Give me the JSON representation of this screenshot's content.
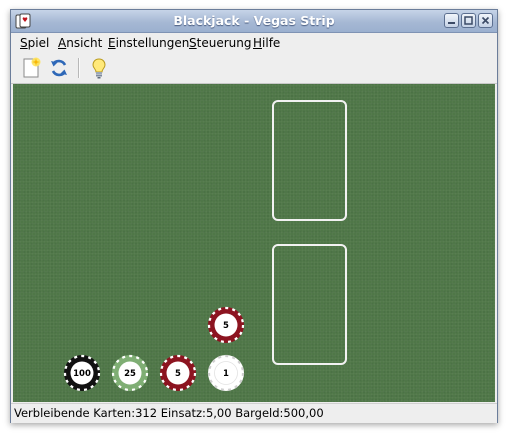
{
  "window": {
    "title": "Blackjack - Vegas Strip",
    "buttons": [
      "minimize-icon",
      "maximize-icon",
      "close-icon"
    ]
  },
  "menu": [
    {
      "mnemonic": "S",
      "rest": "piel"
    },
    {
      "mnemonic": "A",
      "rest": "nsicht"
    },
    {
      "mnemonic": "E",
      "rest": "instellungen"
    },
    {
      "mnemonic": "S",
      "rest": "teuerung"
    },
    {
      "mnemonic": "H",
      "rest": "ilfe"
    }
  ],
  "toolbar": {
    "icons": [
      "new-game-icon",
      "restart-icon",
      "hint-lightbulb-icon"
    ]
  },
  "chips": [
    {
      "value": "100",
      "color": "#111111",
      "accent": "#ffffff"
    },
    {
      "value": "25",
      "color": "#7fae74",
      "accent": "#ffffff"
    },
    {
      "value": "5",
      "color": "#8c1420",
      "accent": "#ffffff"
    },
    {
      "value": "1",
      "color": "#ffffff",
      "accent": "#cfcfcf"
    },
    {
      "value": "5",
      "color": "#8c1420",
      "accent": "#ffffff"
    }
  ],
  "colors": {
    "felt": "#4f7748",
    "card_outline": "#f2f2f2"
  },
  "status": {
    "cards_label": "Verbleibende Karten:",
    "cards_value": "312",
    "stake_label": "Einsatz:",
    "stake_value": "5,00",
    "cash_label": "Bargeld:",
    "cash_value": "500,00"
  }
}
